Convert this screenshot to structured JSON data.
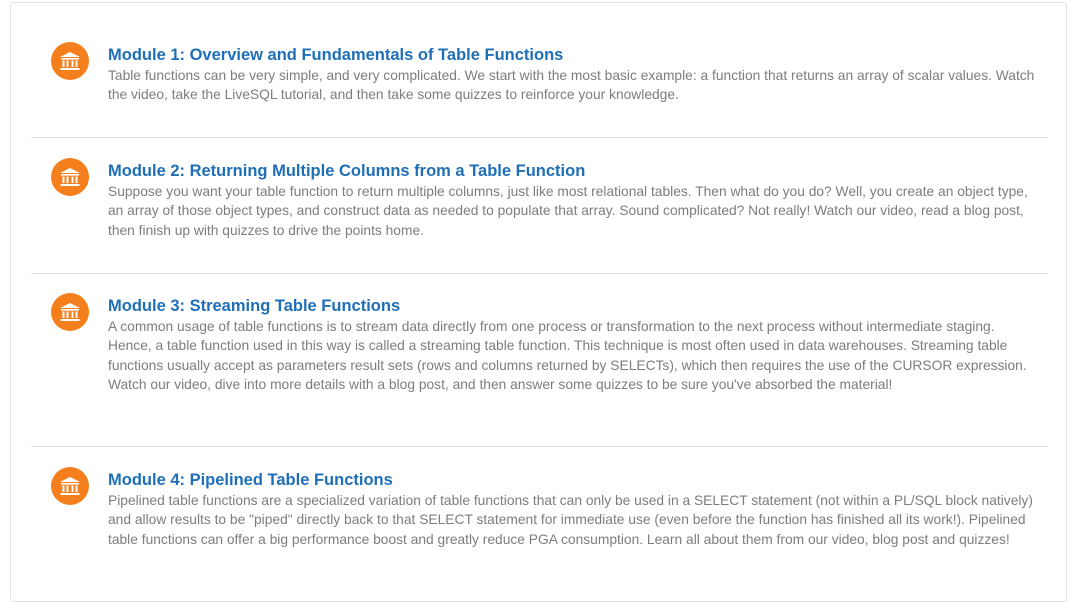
{
  "modules": [
    {
      "icon": "institution-icon",
      "title": "Module 1: Overview and Fundamentals of Table Functions",
      "description": "Table functions can be very simple, and very complicated. We start with the most basic example: a function that returns an array of scalar values. Watch the video, take the LiveSQL tutorial, and then take some quizzes to reinforce your knowledge."
    },
    {
      "icon": "institution-icon",
      "title": "Module 2: Returning Multiple Columns from a Table Function",
      "description": "Suppose you want your table function to return multiple columns, just like most relational tables. Then what do you do? Well, you create an object type, an array of those object types, and construct data as needed to populate that array. Sound complicated? Not really! Watch our video, read a blog post, then finish up with quizzes to drive the points home."
    },
    {
      "icon": "institution-icon",
      "title": "Module 3: Streaming Table Functions",
      "description": "A common usage of table functions is to stream data directly from one process or transformation to the next process without intermediate staging. Hence, a table function used in this way is called a streaming table function. This technique is most often used in data warehouses. Streaming table functions usually accept as parameters result sets (rows and columns returned by SELECTs), which then requires the use of the CURSOR expression. Watch our video, dive into more details with a blog post, and then answer some quizzes to be sure you've absorbed the material!"
    },
    {
      "icon": "institution-icon",
      "title": "Module 4: Pipelined Table Functions",
      "description": "Pipelined table functions are a specialized variation of table functions that can only be used in a SELECT statement (not within a PL/SQL block natively) and allow results to be \"piped\" directly back to that SELECT statement for immediate use (even before the function has finished all its work!). Pipelined table functions can offer a big performance boost and greatly reduce PGA consumption. Learn all about them from our video, blog post and quizzes!"
    }
  ],
  "colors": {
    "icon_bg": "#f47f1c",
    "title": "#1f6fb7",
    "description": "#7d7d7d",
    "divider": "#e1e1e1"
  }
}
